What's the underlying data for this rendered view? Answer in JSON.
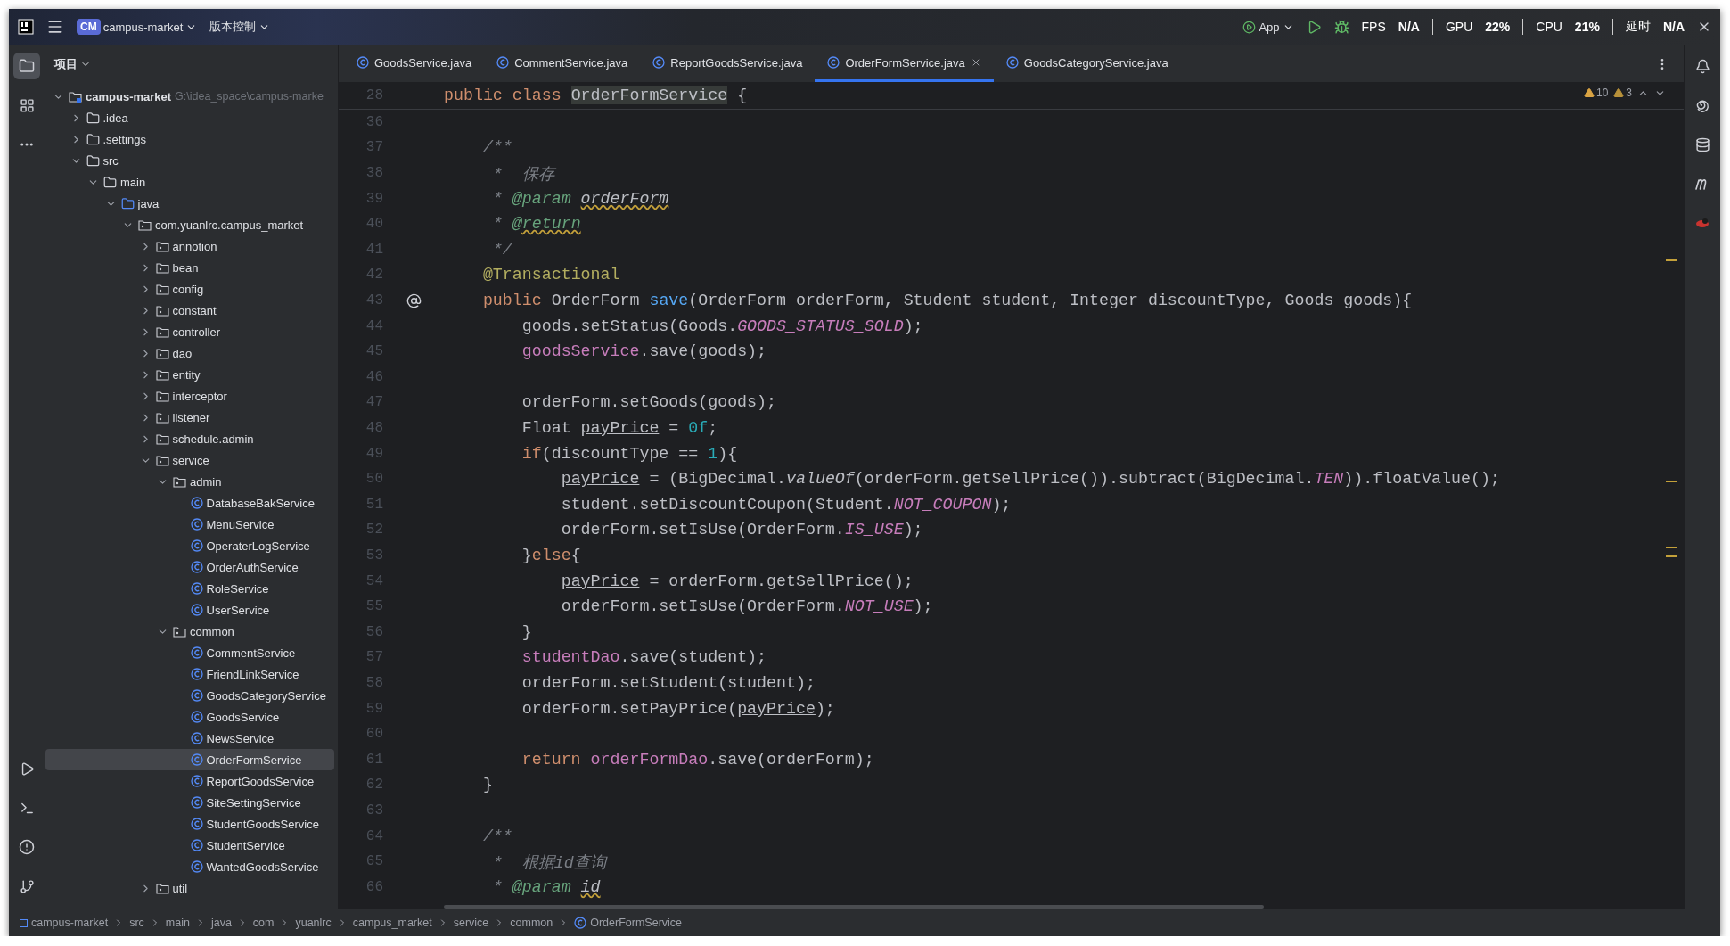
{
  "title_bar": {
    "project_badge": "CM",
    "project": "campus-market",
    "vcs": "版本控制",
    "run_config": "App",
    "stats": [
      {
        "label": "FPS",
        "value": "N/A"
      },
      {
        "label": "GPU",
        "value": "22%"
      },
      {
        "label": "CPU",
        "value": "21%"
      },
      {
        "label": "延时",
        "value": "N/A"
      }
    ]
  },
  "project_panel": {
    "title": "项目"
  },
  "tree": [
    {
      "label": "campus-market",
      "path": "G:\\idea_space\\campus-marke",
      "kind": "module",
      "expanded": true,
      "selected": false,
      "children": [
        {
          "label": ".idea",
          "kind": "folder",
          "expanded": false,
          "selected": false
        },
        {
          "label": ".settings",
          "kind": "folder",
          "expanded": false,
          "selected": false
        },
        {
          "label": "src",
          "kind": "folder",
          "expanded": true,
          "selected": false,
          "children": [
            {
              "label": "main",
              "kind": "folder",
              "expanded": true,
              "selected": false,
              "children": [
                {
                  "label": "java",
                  "kind": "source",
                  "expanded": true,
                  "selected": false,
                  "children": [
                    {
                      "label": "com.yuanlrc.campus_market",
                      "kind": "package",
                      "expanded": true,
                      "selected": false,
                      "children": [
                        {
                          "label": "annotion",
                          "kind": "package",
                          "expanded": false,
                          "selected": false
                        },
                        {
                          "label": "bean",
                          "kind": "package",
                          "expanded": false,
                          "selected": false
                        },
                        {
                          "label": "config",
                          "kind": "package",
                          "expanded": false,
                          "selected": false
                        },
                        {
                          "label": "constant",
                          "kind": "package",
                          "expanded": false,
                          "selected": false
                        },
                        {
                          "label": "controller",
                          "kind": "package",
                          "expanded": false,
                          "selected": false
                        },
                        {
                          "label": "dao",
                          "kind": "package",
                          "expanded": false,
                          "selected": false
                        },
                        {
                          "label": "entity",
                          "kind": "package",
                          "expanded": false,
                          "selected": false
                        },
                        {
                          "label": "interceptor",
                          "kind": "package",
                          "expanded": false,
                          "selected": false
                        },
                        {
                          "label": "listener",
                          "kind": "package",
                          "expanded": false,
                          "selected": false
                        },
                        {
                          "label": "schedule.admin",
                          "kind": "package",
                          "expanded": false,
                          "selected": false
                        },
                        {
                          "label": "service",
                          "kind": "package",
                          "expanded": true,
                          "selected": false,
                          "children": [
                            {
                              "label": "admin",
                              "kind": "package",
                              "expanded": true,
                              "selected": false,
                              "children": [
                                {
                                  "label": "DatabaseBakService",
                                  "kind": "class",
                                  "selected": false
                                },
                                {
                                  "label": "MenuService",
                                  "kind": "class",
                                  "selected": false
                                },
                                {
                                  "label": "OperaterLogService",
                                  "kind": "class",
                                  "selected": false
                                },
                                {
                                  "label": "OrderAuthService",
                                  "kind": "class",
                                  "selected": false
                                },
                                {
                                  "label": "RoleService",
                                  "kind": "class",
                                  "selected": false
                                },
                                {
                                  "label": "UserService",
                                  "kind": "class",
                                  "selected": false
                                }
                              ]
                            },
                            {
                              "label": "common",
                              "kind": "package",
                              "expanded": true,
                              "selected": false,
                              "children": [
                                {
                                  "label": "CommentService",
                                  "kind": "class",
                                  "selected": false
                                },
                                {
                                  "label": "FriendLinkService",
                                  "kind": "class",
                                  "selected": false
                                },
                                {
                                  "label": "GoodsCategoryService",
                                  "kind": "class",
                                  "selected": false
                                },
                                {
                                  "label": "GoodsService",
                                  "kind": "class",
                                  "selected": false
                                },
                                {
                                  "label": "NewsService",
                                  "kind": "class",
                                  "selected": false
                                },
                                {
                                  "label": "OrderFormService",
                                  "kind": "class",
                                  "selected": true
                                },
                                {
                                  "label": "ReportGoodsService",
                                  "kind": "class",
                                  "selected": false
                                },
                                {
                                  "label": "SiteSettingService",
                                  "kind": "class",
                                  "selected": false
                                },
                                {
                                  "label": "StudentGoodsService",
                                  "kind": "class",
                                  "selected": false
                                },
                                {
                                  "label": "StudentService",
                                  "kind": "class",
                                  "selected": false
                                },
                                {
                                  "label": "WantedGoodsService",
                                  "kind": "class",
                                  "selected": false
                                }
                              ]
                            }
                          ]
                        },
                        {
                          "label": "util",
                          "kind": "package",
                          "expanded": false,
                          "selected": false
                        }
                      ]
                    }
                  ]
                }
              ]
            }
          ]
        }
      ]
    }
  ],
  "tabs": [
    {
      "label": "GoodsService.java",
      "selected": false
    },
    {
      "label": "CommentService.java",
      "selected": false
    },
    {
      "label": "ReportGoodsService.java",
      "selected": false
    },
    {
      "label": "OrderFormService.java",
      "selected": true
    },
    {
      "label": "GoodsCategoryService.java",
      "selected": false
    }
  ],
  "inspections": {
    "warnings": "10",
    "weak_warnings": "3"
  },
  "sticky_line": {
    "number": "28",
    "tokens": [
      {
        "kind": "kw",
        "text": "public class "
      },
      {
        "kind": "highlight",
        "text": "OrderFormService"
      },
      {
        "kind": "plain",
        "text": " {"
      }
    ]
  },
  "code_lines": [
    {
      "number": "36"
    },
    {
      "number": "37",
      "tokens": [
        {
          "kind": "comment",
          "text": "    /**"
        }
      ]
    },
    {
      "number": "38",
      "tokens": [
        {
          "kind": "comment",
          "text": "     *  保存"
        }
      ]
    },
    {
      "number": "39",
      "tokens": [
        {
          "kind": "comment",
          "text": "     * "
        },
        {
          "kind": "doctag",
          "text": "@param "
        },
        {
          "kind": "docwarn",
          "text": "orderForm"
        }
      ]
    },
    {
      "number": "40",
      "tokens": [
        {
          "kind": "comment",
          "text": "     * "
        },
        {
          "kind": "doctagwarn",
          "text": "@return"
        }
      ]
    },
    {
      "number": "41",
      "tokens": [
        {
          "kind": "comment",
          "text": "     */"
        }
      ]
    },
    {
      "number": "42",
      "tokens": [
        {
          "kind": "annot",
          "text": "    @Transactional"
        }
      ]
    },
    {
      "number": "43",
      "marker": true,
      "tokens": [
        {
          "kind": "kw",
          "text": "    public "
        },
        {
          "kind": "plain",
          "text": "OrderForm "
        },
        {
          "kind": "fn",
          "text": "save"
        },
        {
          "kind": "plain",
          "text": "(OrderForm orderForm, Student student, Integer discountType, Goods goods){"
        }
      ]
    },
    {
      "number": "44",
      "tokens": [
        {
          "kind": "plain",
          "text": "        goods.setStatus(Goods."
        },
        {
          "kind": "const",
          "text": "GOODS_STATUS_SOLD"
        },
        {
          "kind": "plain",
          "text": ");"
        }
      ]
    },
    {
      "number": "45",
      "tokens": [
        {
          "kind": "field",
          "text": "        goodsService"
        },
        {
          "kind": "plain",
          "text": ".save(goods);"
        }
      ]
    },
    {
      "number": "46"
    },
    {
      "number": "47",
      "tokens": [
        {
          "kind": "plain",
          "text": "        orderForm.setGoods(goods);"
        }
      ]
    },
    {
      "number": "48",
      "tokens": [
        {
          "kind": "plain",
          "text": "        Float "
        },
        {
          "kind": "reassigned",
          "text": "payPrice"
        },
        {
          "kind": "plain",
          "text": " = "
        },
        {
          "kind": "num",
          "text": "0f"
        },
        {
          "kind": "plain",
          "text": ";"
        }
      ]
    },
    {
      "number": "49",
      "tokens": [
        {
          "kind": "kw",
          "text": "        if"
        },
        {
          "kind": "plain",
          "text": "(discountType == "
        },
        {
          "kind": "num",
          "text": "1"
        },
        {
          "kind": "plain",
          "text": "){"
        }
      ]
    },
    {
      "number": "50",
      "tokens": [
        {
          "kind": "reassigned",
          "text": "            payPrice"
        },
        {
          "kind": "plain",
          "text": " = (BigDecimal."
        },
        {
          "kind": "static",
          "text": "valueOf"
        },
        {
          "kind": "plain",
          "text": "(orderForm.getSellPrice()).subtract(BigDecimal."
        },
        {
          "kind": "const",
          "text": "TEN"
        },
        {
          "kind": "plain",
          "text": ")).floatValue();"
        }
      ]
    },
    {
      "number": "51",
      "tokens": [
        {
          "kind": "plain",
          "text": "            student.setDiscountCoupon(Student."
        },
        {
          "kind": "const",
          "text": "NOT_COUPON"
        },
        {
          "kind": "plain",
          "text": ");"
        }
      ]
    },
    {
      "number": "52",
      "tokens": [
        {
          "kind": "plain",
          "text": "            orderForm.setIsUse(OrderForm."
        },
        {
          "kind": "const",
          "text": "IS_USE"
        },
        {
          "kind": "plain",
          "text": ");"
        }
      ]
    },
    {
      "number": "53",
      "tokens": [
        {
          "kind": "plain",
          "text": "        }"
        },
        {
          "kind": "kw",
          "text": "else"
        },
        {
          "kind": "plain",
          "text": "{"
        }
      ]
    },
    {
      "number": "54",
      "tokens": [
        {
          "kind": "reassigned",
          "text": "            payPrice"
        },
        {
          "kind": "plain",
          "text": " = orderForm.getSellPrice();"
        }
      ]
    },
    {
      "number": "55",
      "tokens": [
        {
          "kind": "plain",
          "text": "            orderForm.setIsUse(OrderForm."
        },
        {
          "kind": "const",
          "text": "NOT_USE"
        },
        {
          "kind": "plain",
          "text": ");"
        }
      ]
    },
    {
      "number": "56",
      "tokens": [
        {
          "kind": "plain",
          "text": "        }"
        }
      ]
    },
    {
      "number": "57",
      "tokens": [
        {
          "kind": "field",
          "text": "        studentDao"
        },
        {
          "kind": "plain",
          "text": ".save(student);"
        }
      ]
    },
    {
      "number": "58",
      "tokens": [
        {
          "kind": "plain",
          "text": "        orderForm.setStudent(student);"
        }
      ]
    },
    {
      "number": "59",
      "tokens": [
        {
          "kind": "plain",
          "text": "        orderForm.setPayPrice("
        },
        {
          "kind": "reassigned",
          "text": "payPrice"
        },
        {
          "kind": "plain",
          "text": ");"
        }
      ]
    },
    {
      "number": "60"
    },
    {
      "number": "61",
      "tokens": [
        {
          "kind": "kw",
          "text": "        return "
        },
        {
          "kind": "field",
          "text": "orderFormDao"
        },
        {
          "kind": "plain",
          "text": ".save(orderForm);"
        }
      ]
    },
    {
      "number": "62",
      "tokens": [
        {
          "kind": "plain",
          "text": "    }"
        }
      ]
    },
    {
      "number": "63"
    },
    {
      "number": "64",
      "tokens": [
        {
          "kind": "comment",
          "text": "    /**"
        }
      ]
    },
    {
      "number": "65",
      "tokens": [
        {
          "kind": "comment",
          "text": "     *  根据id查询"
        }
      ]
    },
    {
      "number": "66",
      "tokens": [
        {
          "kind": "comment",
          "text": "     * "
        },
        {
          "kind": "doctag",
          "text": "@param "
        },
        {
          "kind": "docwarn",
          "text": "id"
        }
      ]
    }
  ],
  "breadcrumbs": [
    "campus-market",
    "src",
    "main",
    "java",
    "com",
    "yuanlrc",
    "campus_market",
    "service",
    "common",
    "OrderFormService"
  ]
}
